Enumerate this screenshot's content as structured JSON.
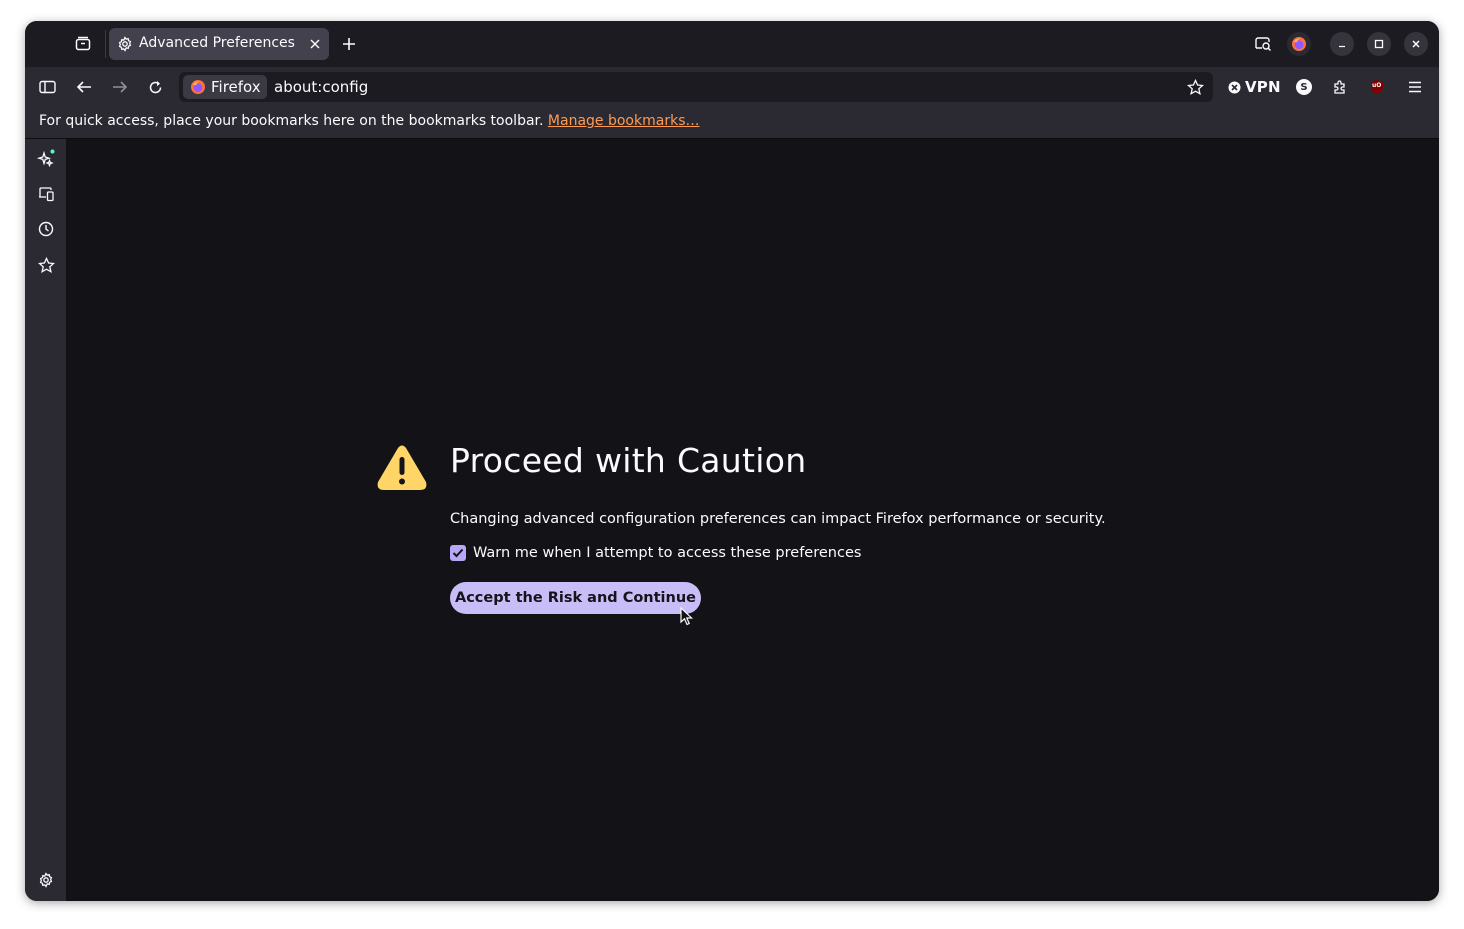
{
  "tab": {
    "title": "Advanced Preferences"
  },
  "navbar": {
    "identity_label": "Firefox",
    "url": "about:config",
    "vpn_label": "VPN",
    "account_initial": "S",
    "ublock_label": "uO"
  },
  "bookmarks_bar": {
    "message": "For quick access, place your bookmarks here on the bookmarks toolbar.",
    "link_text": "Manage bookmarks…"
  },
  "page": {
    "title": "Proceed with Caution",
    "description": "Changing advanced configuration preferences can impact Firefox performance or security.",
    "checkbox_label": "Warn me when I attempt to access these preferences",
    "checkbox_checked": true,
    "accept_button": "Accept the Risk and Continue"
  },
  "colors": {
    "window_bg": "#1c1b22",
    "toolbar_bg": "#2b2a33",
    "content_bg": "#131317",
    "accent": "#c9bdf7",
    "link": "#ff9a52",
    "warning": "#ffd567"
  }
}
